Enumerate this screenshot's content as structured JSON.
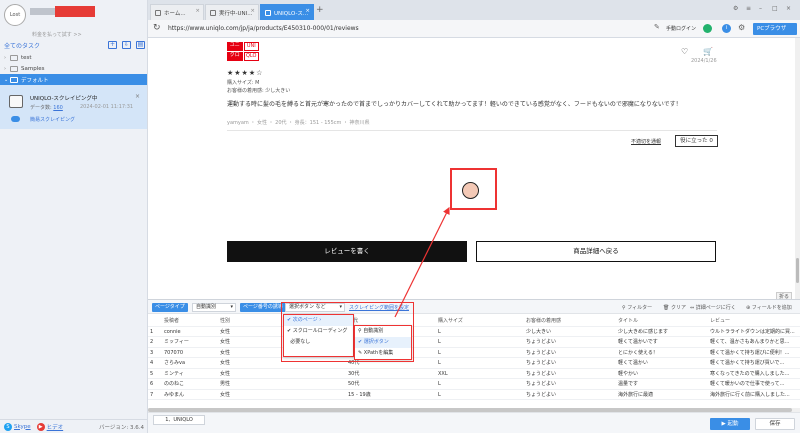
{
  "sidebar": {
    "avatar_text": "Lost",
    "plan_text": "料金を払って試す >>",
    "all_tasks": "全てのタスク",
    "tree": [
      {
        "label": "test"
      },
      {
        "label": "Samples"
      },
      {
        "label": "デフォルト"
      }
    ],
    "task": {
      "name": "UNIQLO-スクレイピング中",
      "data_label": "データ数:",
      "data_count": "160",
      "date": "2024-02-01 11:17:31",
      "status": "簡易スクレイピング"
    },
    "footer": {
      "skype": "Skype",
      "tutorial": "ヒデオ",
      "version": "バージョン: 3.6.4"
    }
  },
  "browser": {
    "tabs": [
      {
        "label": "ホーム..."
      },
      {
        "label": "実行中-UNI..."
      },
      {
        "label": "UNIQLO-ス..."
      }
    ],
    "url": "https://www.uniqlo.com/jp/ja/products/E450310-000/01/reviews",
    "login_label": "手動ログイン",
    "browser_btn": "PCブラウザ"
  },
  "page": {
    "logo": [
      "ユニ",
      "UNI",
      "クロ",
      "QLO"
    ],
    "review_date": "2024/1/26",
    "stars": "★★★★☆",
    "size": "購入サイズ: M",
    "fit": "お客様の着用感: 少し大きい",
    "body": "運動する時に髪の毛を縛ると首元が寒かったので首までしっかりカバーしてくれて助かってます！軽いのできている感覚がなく、フードもないので邪魔になりないです！",
    "meta": "yamyam ・ 女性 ・ 20代 ・ 身長：151 - 155cm ・ 神奈川県",
    "report": "不適切を通報",
    "helpful": "役に立った 0",
    "write_btn": "レビューを書く",
    "back_btn": "商品詳細へ戻る",
    "collapse": "折る"
  },
  "panel": {
    "page_type_label": "ページタイプ",
    "page_type_value": "自動識別",
    "page_turn_label": "ページ番号の誘導",
    "page_turn_value": "選択ボタン など",
    "scrape_link": "スクレイピング範囲を設定",
    "tools": {
      "filter": "フィルター",
      "clear": "クリア",
      "detail": "詳細ページに行く",
      "add_field": "フィールドを追加"
    },
    "dropdown": [
      "次のページ",
      "スクロールローディング",
      "必要なし"
    ],
    "submenu": [
      "自動識別",
      "選択ボタン",
      "XPathを編集"
    ],
    "columns": [
      "",
      "投稿者",
      "性別",
      "",
      "年代",
      "購入サイズ",
      "お客様の着用感",
      "タイトル",
      "レビュー"
    ],
    "rows": [
      [
        "1",
        "connie",
        "女性",
        "",
        "",
        "L",
        "少し大きい",
        "少し大きめに感じます",
        "ウルトラライトダウンは定期的に買..."
      ],
      [
        "2",
        "ミッフィー",
        "女性",
        "",
        "",
        "L",
        "ちょうどよい",
        "軽くて温かいです",
        "軽くて、温かさもあんまりかと思..."
      ],
      [
        "3",
        "707070",
        "女性",
        "",
        "30代",
        "L",
        "ちょうどよい",
        "とにかく使える！",
        "軽くて温かくて持ち運びに便利！..."
      ],
      [
        "4",
        "さらみva",
        "女性",
        "",
        "40代",
        "L",
        "ちょうどよい",
        "軽くて温かい",
        "軽くて温かくて持ち運び買いで..."
      ],
      [
        "5",
        "ミンティ",
        "女性",
        "",
        "30代",
        "XXL",
        "ちょうどよい",
        "軽やかい",
        "寒くなってきたので購入しました..."
      ],
      [
        "6",
        "ののねこ",
        "男性",
        "",
        "50代",
        "L",
        "ちょうどよい",
        "温量です",
        "軽くて暖かいので仕事で使って..."
      ],
      [
        "7",
        "みゆまん",
        "女性",
        "",
        "15 - 19歳",
        "L",
        "ちょうどよい",
        "海外旅行に最適",
        "海外旅行に行く前に購入しました..."
      ]
    ],
    "bottom_tab": "1、UNIQLO",
    "run_btn": "起動",
    "save_btn": "保存"
  },
  "colors": {
    "accent": "#3a8ee6",
    "highlight": "#e33333",
    "target_fill": "#f4c9b6"
  },
  "icons": [
    "reload-icon",
    "heart-icon",
    "cart-icon",
    "filter-icon",
    "trash-icon",
    "gear-icon",
    "close-icon",
    "folder-icon"
  ]
}
